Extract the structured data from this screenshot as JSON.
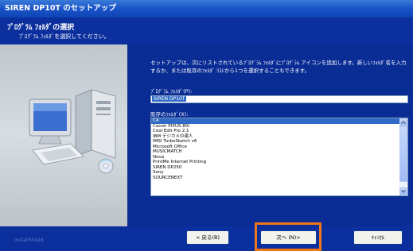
{
  "window": {
    "title": "SIREN DP10T のセットアップ"
  },
  "header": {
    "title": "ﾌﾟﾛｸﾞﾗﾑ ﾌｫﾙﾀﾞの選択",
    "subtitle": "ﾌﾟﾛｸﾞﾗﾑ ﾌｫﾙﾀﾞを選択してください。"
  },
  "content": {
    "description": "セットアップは、次にリストされているﾌﾟﾛｸﾞﾗﾑ ﾌｫﾙﾀﾞにﾌﾟﾛｸﾞﾗﾑ アイコンを追加します。新しいﾌｫﾙﾀﾞ名を入力するか、または既存のﾌｫﾙﾀﾞ ﾘｽﾄから1つを選択することもできます。",
    "program_folder_label": "ﾌﾟﾛｸﾞﾗﾑ ﾌｫﾙﾀﾞ(P):",
    "program_folder_value": "SIREN DP10T",
    "existing_folders_label": "既存のﾌｫﾙﾀﾞ(X):",
    "existing_folders": [
      "CA",
      "Canon PIXUS 80i",
      "Cool Edit Pro 2.1",
      "IBM デジカメの達人",
      "IMSI TurboSketch v6",
      "Microsoft Office",
      "MUSICMATCH",
      "Nova",
      "PrintMe Internet Printing",
      "SIREN DP250",
      "Sony",
      "SOURCENEXT"
    ],
    "selected_folder": "CA"
  },
  "footer": {
    "brand": "InstallShield",
    "back_label": "< 戻る(B)",
    "next_label": "次へ (N)>",
    "cancel_label": "ｷｬﾝｾﾙ"
  },
  "highlight_color": "#f07618"
}
